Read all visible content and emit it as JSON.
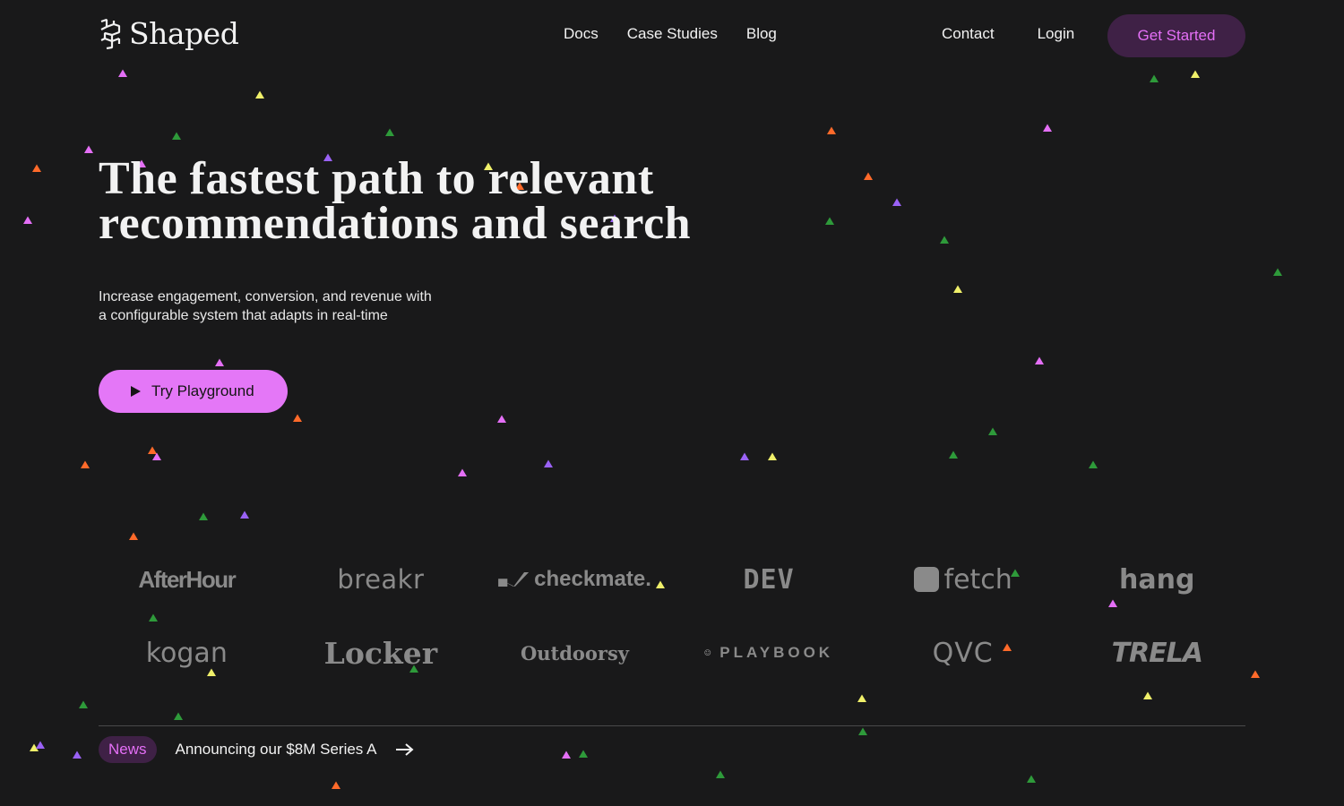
{
  "header": {
    "logo_text": "Shaped",
    "nav": [
      "Docs",
      "Case Studies",
      "Blog"
    ],
    "contact": "Contact",
    "login": "Login",
    "get_started": "Get Started"
  },
  "hero": {
    "title_line1": "The fastest path to relevant",
    "title_line2": "recommendations and search",
    "sub_line1": "Increase engagement, conversion, and revenue with",
    "sub_line2": "a configurable system that adapts in real-time",
    "cta": "Try Playground"
  },
  "logos": {
    "row1": [
      "AfterHour",
      "breakr",
      "checkmate.",
      "DEV",
      "fetch",
      "hang"
    ],
    "row2": [
      "kogan",
      "Locker",
      "Outdoorsy",
      "PLAYBOOK",
      "QVC",
      "TRELA"
    ]
  },
  "news": {
    "badge": "News",
    "text": "Announcing our $8M Series A"
  },
  "colors": {
    "background": "#19191a",
    "accent": "#e477f7",
    "accent_dark": "#3f2146",
    "particle_colors": [
      "#e46ff6",
      "#f0f06a",
      "#2e9a3a",
      "#ff6a2a",
      "#9a62f6"
    ]
  }
}
